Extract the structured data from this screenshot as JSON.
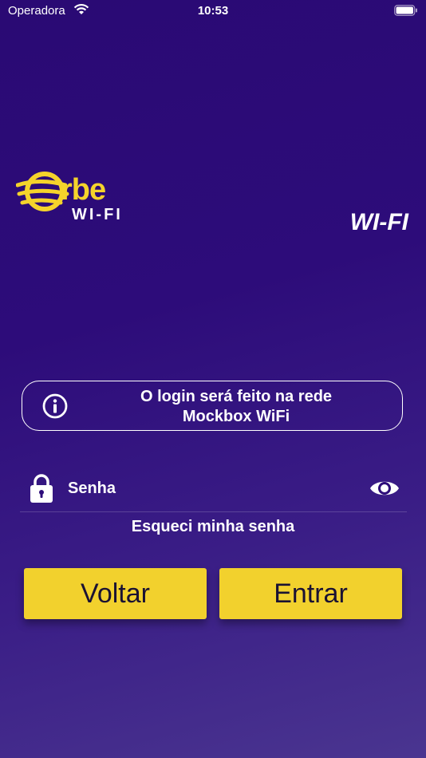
{
  "status_bar": {
    "carrier": "Operadora",
    "time": "10:53"
  },
  "logo": {
    "word": "rbe",
    "subtitle": "WI-FI",
    "color": "#f5d32b"
  },
  "header": {
    "title": "WI-FI"
  },
  "info": {
    "line1": "O login será feito na rede",
    "line2": "Mockbox WiFi"
  },
  "password": {
    "placeholder": "Senha",
    "value": ""
  },
  "forgot_label": "Esqueci minha senha",
  "buttons": {
    "back": "Voltar",
    "enter": "Entrar",
    "color": "#f2d12d"
  },
  "icons": [
    "wifi-icon",
    "battery-icon",
    "info-icon",
    "lock-icon",
    "eye-icon"
  ]
}
